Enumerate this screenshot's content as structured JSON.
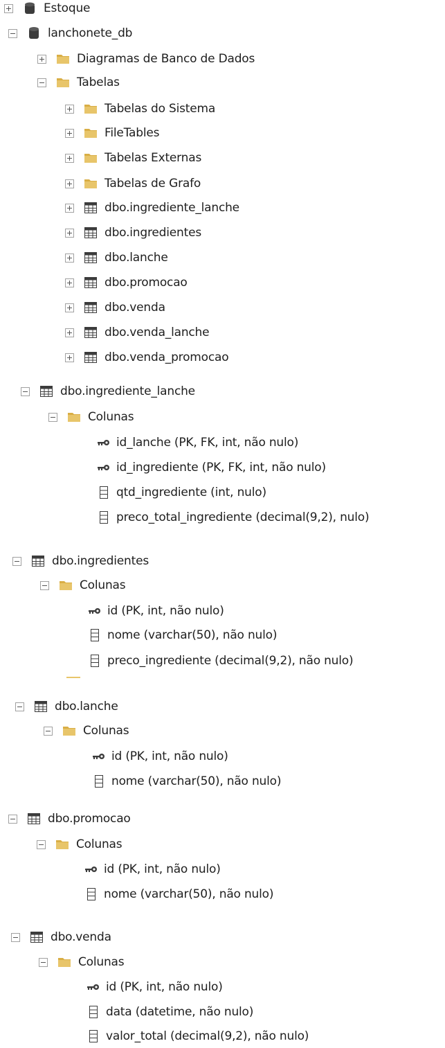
{
  "tree": {
    "estoque_label": "Estoque",
    "db_label": "lanchonete_db",
    "diagrams_label": "Diagramas de Banco de Dados",
    "tables_label": "Tabelas",
    "folders": [
      "Tabelas do Sistema",
      "FileTables",
      "Tabelas Externas",
      "Tabelas de Grafo"
    ],
    "tables": [
      "dbo.ingrediente_lanche",
      "dbo.ingredientes",
      "dbo.lanche",
      "dbo.promocao",
      "dbo.venda",
      "dbo.venda_lanche",
      "dbo.venda_promocao"
    ]
  },
  "sections": [
    {
      "table": "dbo.ingrediente_lanche",
      "folder": "Colunas",
      "columns": [
        "id_lanche (PK, FK, int, não nulo)",
        "id_ingrediente (PK, FK, int, não nulo)",
        "qtd_ingrediente (int, nulo)",
        "preco_total_ingrediente (decimal(9,2), nulo)"
      ]
    },
    {
      "table": "dbo.ingredientes",
      "folder": "Colunas",
      "columns": [
        "id (PK, int, não nulo)",
        "nome (varchar(50), não nulo)",
        "preco_ingrediente (decimal(9,2), não nulo)"
      ]
    },
    {
      "table": "dbo.lanche",
      "folder": "Colunas",
      "columns": [
        "id (PK, int, não nulo)",
        "nome (varchar(50), não nulo)"
      ]
    },
    {
      "table": "dbo.promocao",
      "folder": "Colunas",
      "columns": [
        "id (PK, int, não nulo)",
        "nome (varchar(50), não nulo)"
      ]
    },
    {
      "table": "dbo.venda",
      "folder": "Colunas",
      "columns": [
        "id (PK, int, não nulo)",
        "data (datetime, não nulo)",
        "valor_total (decimal(9,2), não nulo)"
      ]
    }
  ],
  "colors": {
    "folder": "#e8c56a",
    "folder_dark": "#d9ae45",
    "icon": "#3c3c3c",
    "toggle_border": "#a0a0a0"
  }
}
